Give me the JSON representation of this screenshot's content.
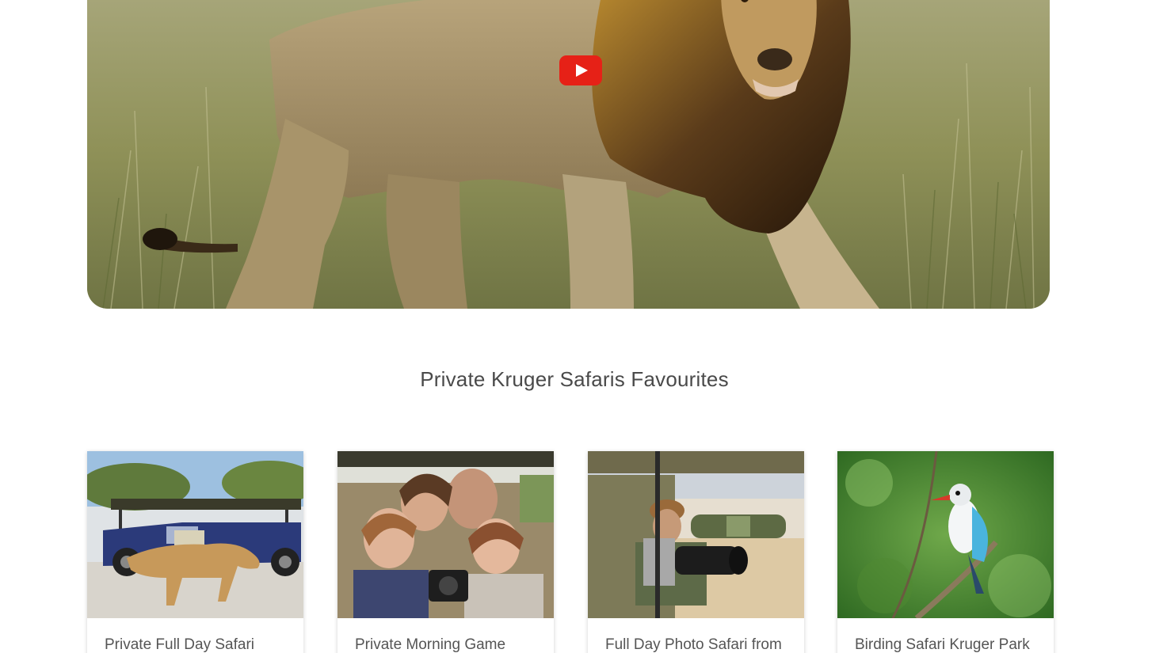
{
  "hero": {
    "image_icon": "lion-video-thumbnail",
    "play_icon": "youtube-play-icon",
    "play_color": "#e62117"
  },
  "section": {
    "title": "Private Kruger Safaris Favourites"
  },
  "cards": [
    {
      "title": "Private Full Day Safari",
      "image_icon": "lioness-and-safari-vehicle-photo"
    },
    {
      "title": "Private Morning Game",
      "image_icon": "family-selfie-in-safari-vehicle-photo"
    },
    {
      "title": "Full Day Photo Safari from",
      "image_icon": "photographer-with-telephoto-lens-photo"
    },
    {
      "title": "Birding Safari Kruger Park",
      "image_icon": "woodland-kingfisher-photo"
    }
  ]
}
